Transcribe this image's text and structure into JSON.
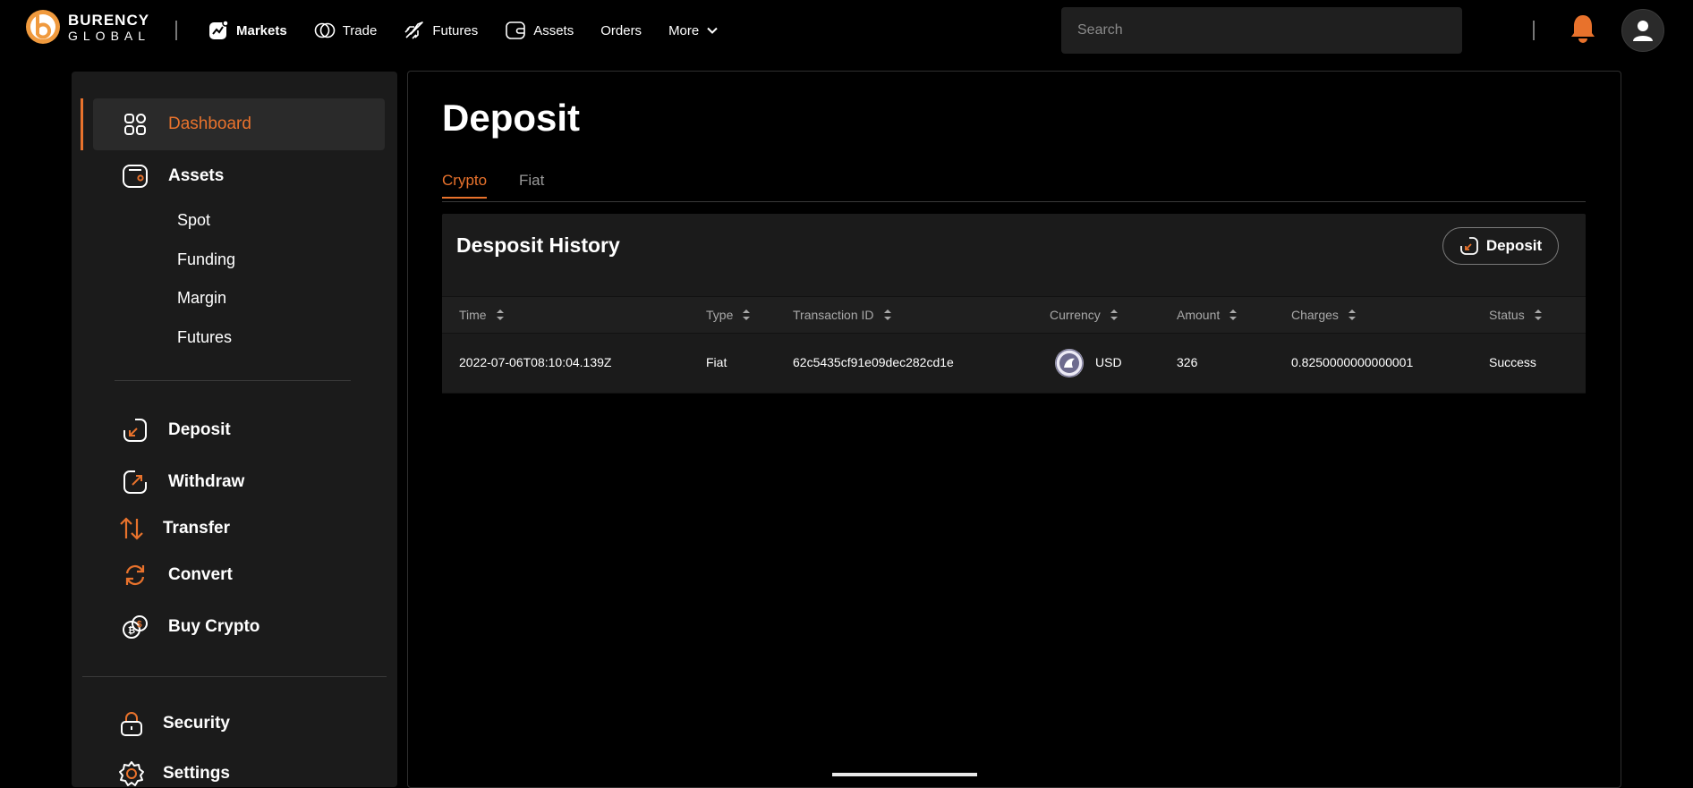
{
  "header": {
    "logo_line1": "BURENCY",
    "logo_line2": "GLOBAL",
    "nav": [
      {
        "label": "Markets",
        "icon": "markets-chart-icon",
        "active": true
      },
      {
        "label": "Trade",
        "icon": "trade-coins-icon"
      },
      {
        "label": "Futures",
        "icon": "futures-rocket-icon"
      },
      {
        "label": "Assets",
        "icon": "wallet-icon"
      },
      {
        "label": "Orders"
      },
      {
        "label": "More",
        "icon": "chevron-down-icon"
      }
    ],
    "search_placeholder": "Search"
  },
  "sidebar": {
    "items": [
      {
        "label": "Dashboard",
        "icon": "dashboard-grid-icon",
        "active": true
      },
      {
        "label": "Assets",
        "icon": "wallet-icon"
      },
      {
        "label": "Deposit",
        "icon": "deposit-icon"
      },
      {
        "label": "Withdraw",
        "icon": "withdraw-icon"
      },
      {
        "label": "Transfer",
        "icon": "transfer-arrows-icon"
      },
      {
        "label": "Convert",
        "icon": "convert-icon"
      },
      {
        "label": "Buy Crypto",
        "icon": "buy-crypto-icon"
      },
      {
        "label": "Security",
        "icon": "lock-icon"
      },
      {
        "label": "Settings",
        "icon": "gear-icon"
      }
    ],
    "asset_subitems": [
      "Spot",
      "Funding",
      "Margin",
      "Futures"
    ]
  },
  "main": {
    "title": "Deposit",
    "tabs": [
      {
        "label": "Crypto",
        "active": true
      },
      {
        "label": "Fiat"
      }
    ],
    "history": {
      "title": "Desposit History",
      "deposit_button": "Deposit",
      "columns": [
        "Time",
        "Type",
        "Transaction ID",
        "Currency",
        "Amount",
        "Charges",
        "Status"
      ],
      "rows": [
        {
          "time": "2022-07-06T08:10:04.139Z",
          "type": "Fiat",
          "transaction_id": "62c5435cf91e09dec282cd1e",
          "currency": "USD",
          "amount": "326",
          "charges": "0.8250000000000001",
          "status": "Success"
        }
      ]
    }
  },
  "colors": {
    "accent": "#e8722c",
    "background": "#000000",
    "panel": "#1b1b1b"
  }
}
